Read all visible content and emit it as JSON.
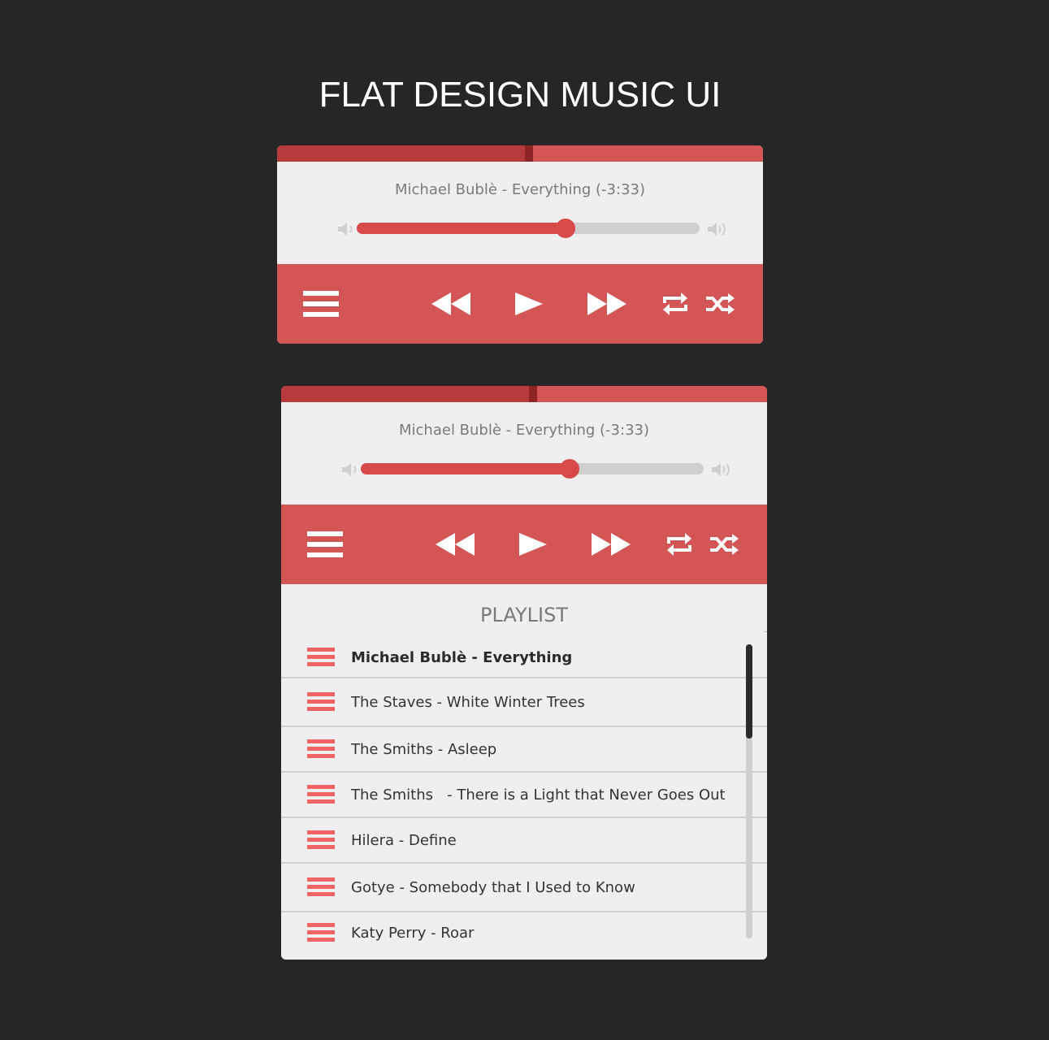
{
  "page": {
    "title": "FLAT DESIGN MUSIC UI"
  },
  "colors": {
    "background": "#262626",
    "accent": "#d45555",
    "accent_dark": "#b73a3c",
    "panel": "#efefef",
    "volume_track": "#cfcfcf",
    "playlist_icon": "#f06466"
  },
  "players": [
    {
      "track_progress": 0.51,
      "now_playing": "Michael Bublè - Everything (-3:33)",
      "volume": 0.61,
      "controls": {
        "menu_icon": "menu-icon",
        "prev_icon": "rewind-icon",
        "play_icon": "play-icon",
        "next_icon": "fast-forward-icon",
        "repeat_icon": "repeat-icon",
        "shuffle_icon": "shuffle-icon"
      }
    },
    {
      "track_progress": 0.51,
      "now_playing": "Michael Bublè - Everything (-3:33)",
      "volume": 0.61,
      "controls": {
        "menu_icon": "menu-icon",
        "prev_icon": "rewind-icon",
        "play_icon": "play-icon",
        "next_icon": "fast-forward-icon",
        "repeat_icon": "repeat-icon",
        "shuffle_icon": "shuffle-icon"
      }
    }
  ],
  "playlist": {
    "title": "PLAYLIST",
    "scroll_position": 0.0,
    "scroll_visible_fraction": 0.32,
    "items": [
      {
        "label": "Michael Bublè - Everything",
        "active": true
      },
      {
        "label": "The Staves - White Winter Trees",
        "active": false
      },
      {
        "label": "The Smiths - Asleep",
        "active": false
      },
      {
        "label": "The Smiths   - There is a Light that Never Goes Out",
        "active": false
      },
      {
        "label": "Hilera - Define",
        "active": false
      },
      {
        "label": "Gotye - Somebody that I Used to Know",
        "active": false
      },
      {
        "label": "Katy Perry - Roar",
        "active": false
      }
    ]
  }
}
